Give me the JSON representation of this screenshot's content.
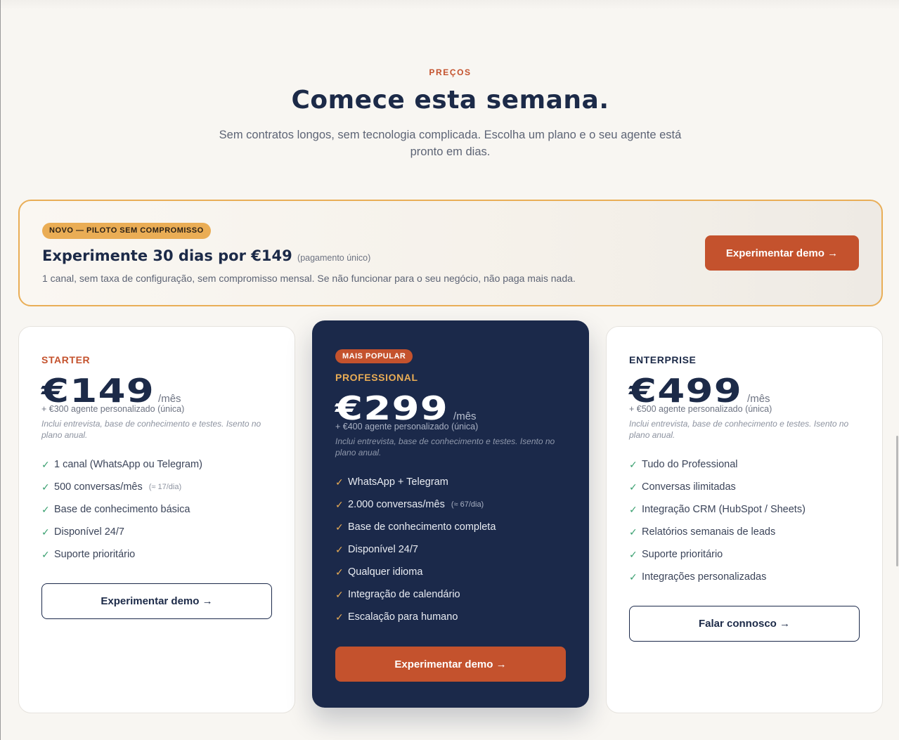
{
  "section": {
    "eyebrow": "PREÇOS",
    "title": "Comece esta semana.",
    "subtitle": "Sem contratos longos, sem tecnologia complicada. Escolha um plano e o seu agente está pronto em dias."
  },
  "pilot": {
    "badge": "NOVO — PILOTO SEM COMPROMISSO",
    "headline": "Experimente 30 dias por €149",
    "headline_note": "(pagamento único)",
    "description": "1 canal, sem taxa de configuração, sem compromisso mensal. Se não funcionar para o seu negócio, não paga mais nada.",
    "cta": "Experimentar demo →"
  },
  "plans": [
    {
      "name": "STARTER",
      "price": "€149",
      "period": "/mês",
      "setup": "+ €300 agente personalizado (única)",
      "setup_note": "Inclui entrevista, base de conhecimento e testes. Isento no plano anual.",
      "features": [
        {
          "text": "1 canal (WhatsApp ou Telegram)",
          "note": ""
        },
        {
          "text": "500 conversas/mês",
          "note": "(≈ 17/dia)"
        },
        {
          "text": "Base de conhecimento básica",
          "note": ""
        },
        {
          "text": "Disponível 24/7",
          "note": ""
        },
        {
          "text": "Suporte prioritário",
          "note": ""
        }
      ],
      "cta": "Experimentar demo →"
    },
    {
      "badge": "MAIS POPULAR",
      "name": "PROFESSIONAL",
      "price": "€299",
      "period": "/mês",
      "setup": "+ €400 agente personalizado (única)",
      "setup_note": "Inclui entrevista, base de conhecimento e testes. Isento no plano anual.",
      "features": [
        {
          "text": "WhatsApp + Telegram",
          "note": ""
        },
        {
          "text": "2.000 conversas/mês",
          "note": "(≈ 67/dia)"
        },
        {
          "text": "Base de conhecimento completa",
          "note": ""
        },
        {
          "text": "Disponível 24/7",
          "note": ""
        },
        {
          "text": "Qualquer idioma",
          "note": ""
        },
        {
          "text": "Integração de calendário",
          "note": ""
        },
        {
          "text": "Escalação para humano",
          "note": ""
        }
      ],
      "cta": "Experimentar demo →"
    },
    {
      "name": "ENTERPRISE",
      "price": "€499",
      "period": "/mês",
      "setup": "+ €500 agente personalizado (única)",
      "setup_note": "Inclui entrevista, base de conhecimento e testes. Isento no plano anual.",
      "features": [
        {
          "text": "Tudo do Professional",
          "note": ""
        },
        {
          "text": "Conversas ilimitadas",
          "note": ""
        },
        {
          "text": "Integração CRM (HubSpot / Sheets)",
          "note": ""
        },
        {
          "text": "Relatórios semanais de leads",
          "note": ""
        },
        {
          "text": "Suporte prioritário",
          "note": ""
        },
        {
          "text": "Integrações personalizadas",
          "note": ""
        }
      ],
      "cta": "Falar connosco →"
    }
  ],
  "icons": {
    "check": "✓"
  },
  "colors": {
    "accent": "#c4522d",
    "navy": "#1b294a",
    "gold": "#eaad55",
    "check_green": "#3aa070"
  }
}
